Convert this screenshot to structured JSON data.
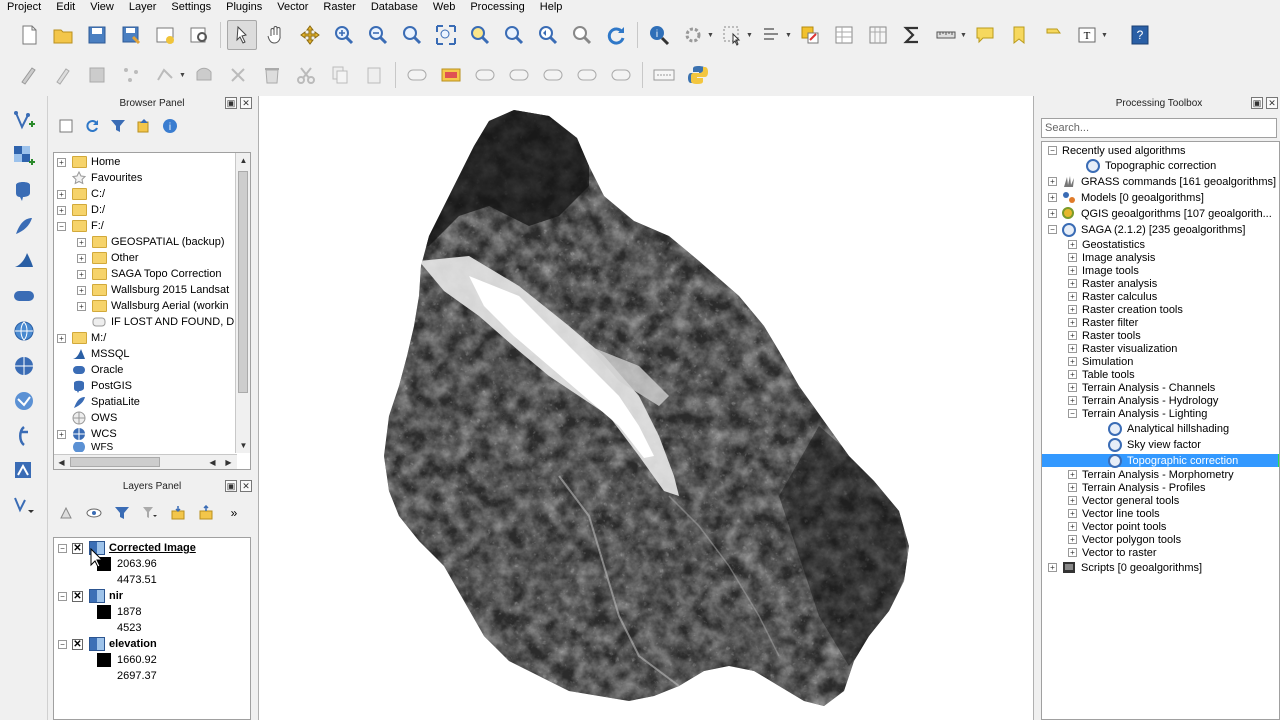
{
  "menu": [
    "Project",
    "Edit",
    "View",
    "Layer",
    "Settings",
    "Plugins",
    "Vector",
    "Raster",
    "Database",
    "Web",
    "Processing",
    "Help"
  ],
  "browser_panel": {
    "title": "Browser Panel",
    "items": [
      {
        "label": "Home",
        "icon": "folder"
      },
      {
        "label": "Favourites",
        "icon": "star"
      },
      {
        "label": "C:/",
        "icon": "folder"
      },
      {
        "label": "D:/",
        "icon": "folder"
      },
      {
        "label": "F:/",
        "icon": "folder"
      },
      {
        "label": "GEOSPATIAL (backup)",
        "icon": "folder"
      },
      {
        "label": "Other",
        "icon": "folder"
      },
      {
        "label": "SAGA Topo Correction",
        "icon": "folder"
      },
      {
        "label": "Wallsburg 2015 Landsat",
        "icon": "folder"
      },
      {
        "label": "Wallsburg Aerial (workin",
        "icon": "folder"
      },
      {
        "label": "IF LOST AND FOUND, D",
        "icon": "file"
      },
      {
        "label": "M:/",
        "icon": "folder"
      },
      {
        "label": "MSSQL",
        "icon": "mssql"
      },
      {
        "label": "Oracle",
        "icon": "oracle"
      },
      {
        "label": "PostGIS",
        "icon": "postgis"
      },
      {
        "label": "SpatiaLite",
        "icon": "spatialite"
      },
      {
        "label": "OWS",
        "icon": "globe"
      },
      {
        "label": "WCS",
        "icon": "globe"
      },
      {
        "label": "WFS",
        "icon": "globe"
      }
    ]
  },
  "layers_panel": {
    "title": "Layers Panel",
    "layers": [
      {
        "name": "Corrected Image",
        "min": "2063.96",
        "max": "4473.51",
        "checked": "✕"
      },
      {
        "name": "nir",
        "min": "1878",
        "max": "4523",
        "checked": "✕"
      },
      {
        "name": "elevation",
        "min": "1660.92",
        "max": "2697.37",
        "checked": "✕"
      }
    ]
  },
  "processing_toolbox": {
    "title": "Processing Toolbox",
    "search_placeholder": "Search...",
    "recent": {
      "label": "Recently used algorithms",
      "child": "Topographic correction"
    },
    "providers": [
      "GRASS commands [161 geoalgorithms]",
      "Models [0 geoalgorithms]",
      "QGIS geoalgorithms [107 geoalgorith...",
      "SAGA (2.1.2) [235 geoalgorithms]"
    ],
    "saga_groups_before": [
      "Geostatistics",
      "Image analysis",
      "Image tools",
      "Raster analysis",
      "Raster calculus",
      "Raster creation tools",
      "Raster filter",
      "Raster tools",
      "Raster visualization",
      "Simulation",
      "Table tools",
      "Terrain Analysis - Channels",
      "Terrain Analysis - Hydrology",
      "Terrain Analysis - Lighting"
    ],
    "lighting_children": [
      "Analytical hillshading",
      "Sky view factor",
      "Topographic correction"
    ],
    "saga_groups_after": [
      "Terrain Analysis - Morphometry",
      "Terrain Analysis - Profiles",
      "Vector general tools",
      "Vector line tools",
      "Vector point tools",
      "Vector polygon tools",
      "Vector to raster"
    ],
    "scripts": "Scripts [0 geoalgorithms]"
  },
  "colors": {
    "selection": "#3399ff",
    "accent_green": "#22dd55",
    "qgis_blue": "#3a6cb5"
  }
}
